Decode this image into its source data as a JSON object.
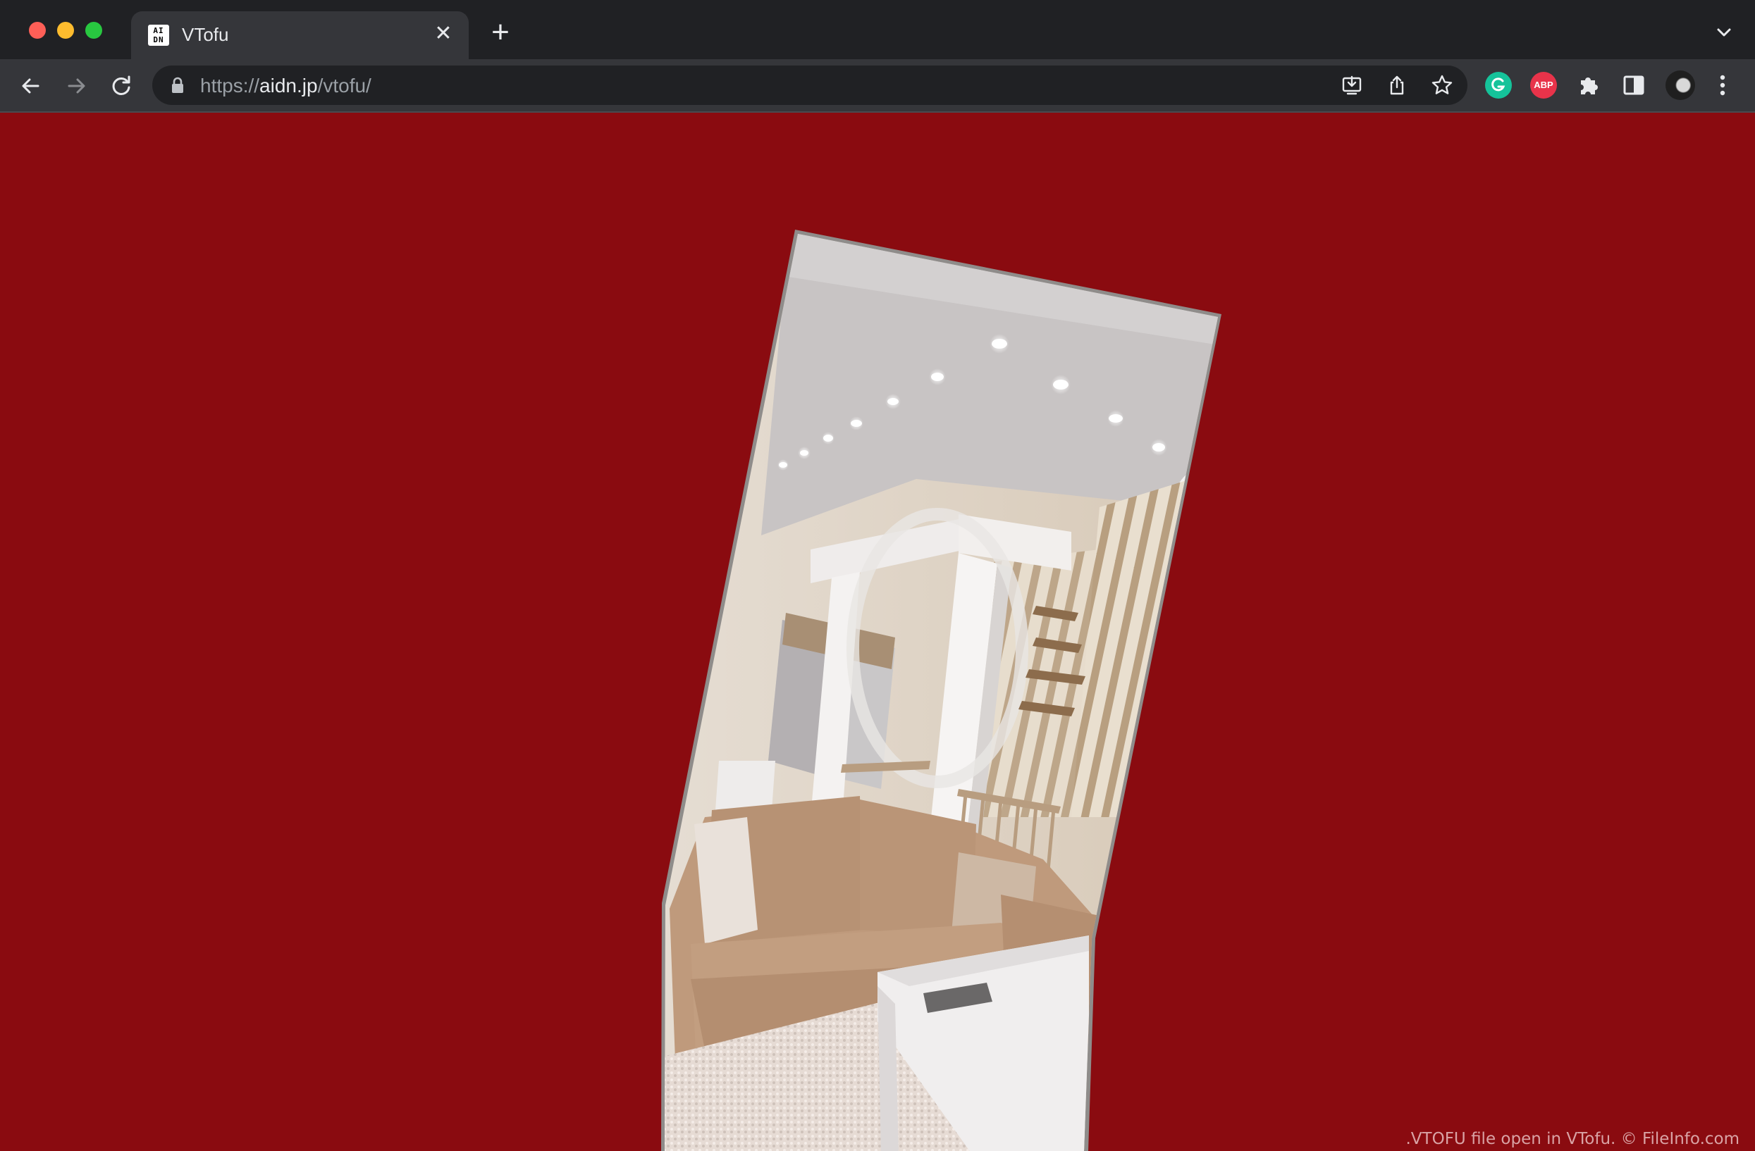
{
  "browser": {
    "tab": {
      "title": "VTofu",
      "favicon_text": "AI DN"
    },
    "address_bar": {
      "scheme": "https://",
      "host": "aidn.jp",
      "path": "/vtofu/"
    },
    "extensions": {
      "abp_label": "ABP"
    }
  },
  "page": {
    "background_color": "#8a0b10",
    "watermark": ".VTOFU file open in VTofu. © FileInfo.com"
  }
}
